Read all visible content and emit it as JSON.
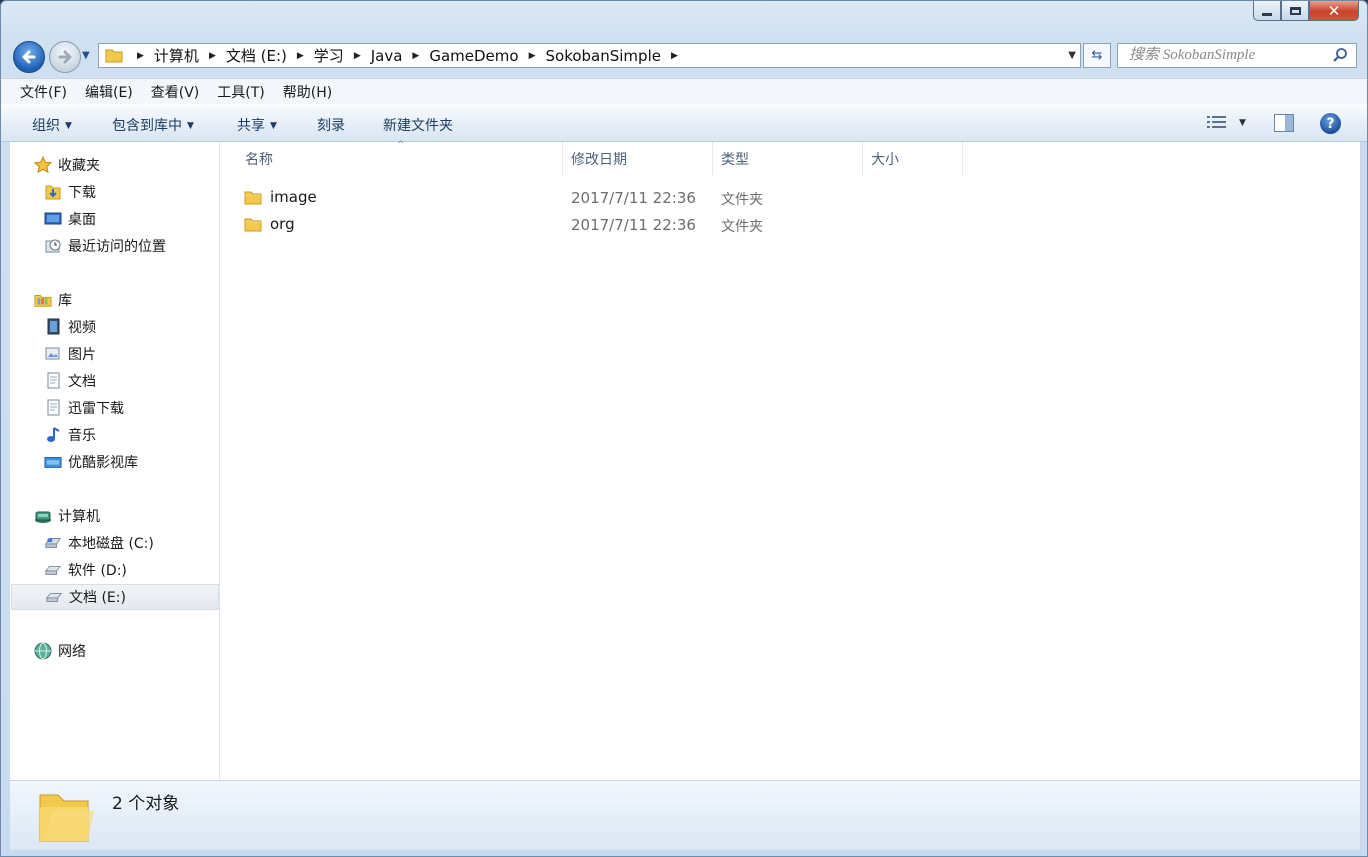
{
  "window": {
    "controls": {
      "minimize": "minimize",
      "maximize": "maximize",
      "close": "✕"
    }
  },
  "address_bar": {
    "breadcrumbs": [
      "计算机",
      "文档 (E:)",
      "学习",
      "Java",
      "GameDemo",
      "SokobanSimple"
    ]
  },
  "search": {
    "placeholder": "搜索 SokobanSimple"
  },
  "menu": [
    "文件(F)",
    "编辑(E)",
    "查看(V)",
    "工具(T)",
    "帮助(H)"
  ],
  "toolbar": {
    "organize": "组织",
    "include_in_library": "包含到库中",
    "share": "共享",
    "burn": "刻录",
    "new_folder": "新建文件夹",
    "help": "?"
  },
  "sidebar": {
    "favorites": {
      "label": "收藏夹",
      "items": [
        "下载",
        "桌面",
        "最近访问的位置"
      ]
    },
    "libraries": {
      "label": "库",
      "items": [
        "视频",
        "图片",
        "文档",
        "迅雷下载",
        "音乐",
        "优酷影视库"
      ]
    },
    "computer": {
      "label": "计算机",
      "items": [
        "本地磁盘 (C:)",
        "软件 (D:)",
        "文档 (E:)"
      ],
      "selected": "文档 (E:)"
    },
    "network": {
      "label": "网络"
    }
  },
  "columns": {
    "name": "名称",
    "date": "修改日期",
    "type": "类型",
    "size": "大小",
    "sort_indicator": "^"
  },
  "files": [
    {
      "name": "image",
      "date": "2017/7/11 22:36",
      "type": "文件夹"
    },
    {
      "name": "org",
      "date": "2017/7/11 22:36",
      "type": "文件夹"
    }
  ],
  "status": {
    "count": "2 个对象"
  },
  "colors": {
    "accent": "#1f5fb3",
    "folder": "#f2c94c",
    "selection": "#e3e8ee"
  }
}
